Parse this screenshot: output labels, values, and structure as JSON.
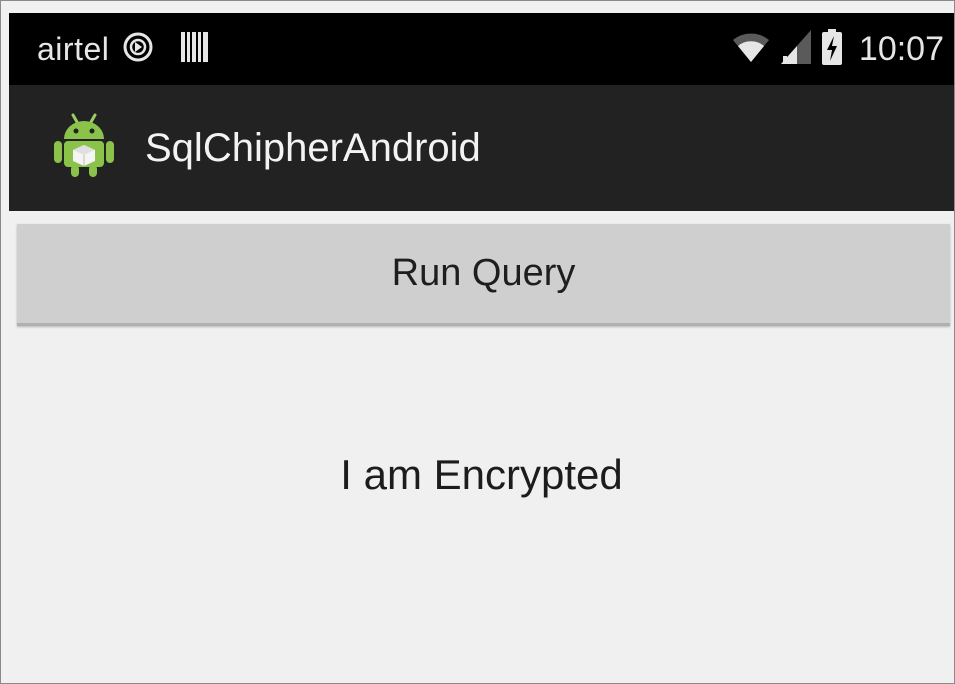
{
  "status_bar": {
    "carrier": "airtel",
    "time": "10:07",
    "icons": [
      "sync-icon",
      "barcode-icon",
      "wifi-icon",
      "signal-icon",
      "battery-charging-icon"
    ]
  },
  "action_bar": {
    "app_icon": "android-icon",
    "title": "SqlChipherAndroid",
    "icon_color": "#8bc34a"
  },
  "main": {
    "run_query_label": "Run Query",
    "result_text": "I am Encrypted"
  },
  "colors": {
    "status_bar_bg": "#000000",
    "action_bar_bg": "#222222",
    "content_bg": "#f0f0f0",
    "button_bg": "#cfcfcf"
  }
}
